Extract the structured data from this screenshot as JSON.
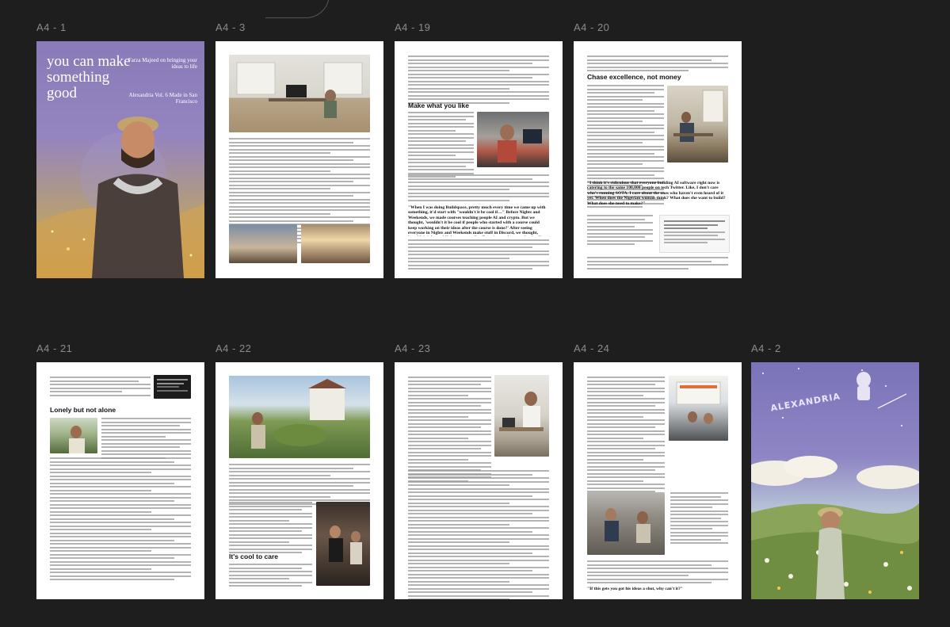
{
  "canvas": {
    "background": "#1e1e1e",
    "label_color": "#8c8c8c"
  },
  "frames": [
    {
      "id": "a4-1",
      "label": "A4 - 1"
    },
    {
      "id": "a4-3",
      "label": "A4 - 3"
    },
    {
      "id": "a4-19",
      "label": "A4 - 19"
    },
    {
      "id": "a4-20",
      "label": "A4 - 20"
    },
    {
      "id": "a4-21",
      "label": "A4 - 21"
    },
    {
      "id": "a4-22",
      "label": "A4 - 22"
    },
    {
      "id": "a4-23",
      "label": "A4 - 23"
    },
    {
      "id": "a4-24",
      "label": "A4 - 24"
    },
    {
      "id": "a4-2",
      "label": "A4 - 2"
    }
  ],
  "cover": {
    "title": "you can make something good",
    "note": "Farza Majeed on bringing your ideas to life",
    "subtitle": "Alexandria Vol. 6 Made in San Francisco"
  },
  "a4_19": {
    "heading": "Make what you like",
    "pull_quote": "\"When I was doing Buildspace, pretty much every time we came up with something, it'd start with \"wouldn't it be cool if…\" Before Nights and Weekends, we made courses teaching people AI and crypto. But we thought, 'wouldn't it be cool if people who started with a course could keep working on their ideas after the course is done?' After seeing everyone in Nights and Weekends make stuff in Discord, we thought, 'wouldn't it be cool if they came to San Francisco and met each other?' For the school, it was like, 'wouldn't it be cool if they worked on their ideas full time?'\""
  },
  "a4_20": {
    "heading": "Chase excellence, not money",
    "pull_quote": "\"I think it's ridiculous that everyone building AI software right now is catering to the same 100,000 people on tech Twitter. Like, I don't care who's running SOTA. I care about the ones who haven't even heard of it yet. When does the Nigerian woman think? What does she want to build? What does she need to make?\""
  },
  "a4_21": {
    "heading": "Lonely but not alone"
  },
  "a4_22": {
    "heading": "It's cool to care"
  },
  "a4_24": {
    "closing_quote": "\"If this gets you got his ideas a shot, why can't it?\""
  },
  "a4_2": {
    "logo_text": "ALEXANDRIA"
  }
}
